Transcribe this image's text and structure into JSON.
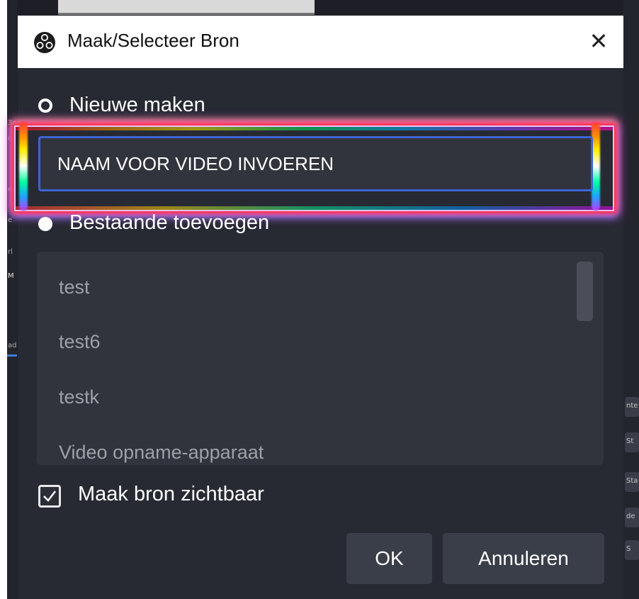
{
  "dialog": {
    "title": "Maak/Selecteer Bron",
    "close_glyph": "✕",
    "new_option_label": "Nieuwe maken",
    "name_input_value": "NAAM VOOR VIDEO INVOEREN",
    "existing_option_label": "Bestaande toevoegen",
    "existing_sources": [
      "test",
      "test6",
      "testk",
      "Video opname-apparaat"
    ],
    "visible_checkbox_label": "Maak bron zichtbaar",
    "visible_checked": true,
    "ok_label": "OK",
    "cancel_label": "Annuleren"
  },
  "background_fragments": {
    "left": [
      "3e",
      "ce",
      "e",
      "e",
      "rl",
      "M",
      "ad"
    ],
    "right": [
      "nte",
      "St",
      "Sta",
      "de",
      "S"
    ]
  },
  "icons": {
    "app_icon": "obs-logo-icon",
    "close": "close-icon",
    "checkbox": "checkmark-icon"
  },
  "colors": {
    "dialog_bg": "#272a33",
    "input_bg": "#31343d",
    "input_border": "#3d63d7",
    "button_bg": "#3a3e48",
    "text_primary": "#ffffff",
    "text_muted": "#9ea0a6"
  }
}
